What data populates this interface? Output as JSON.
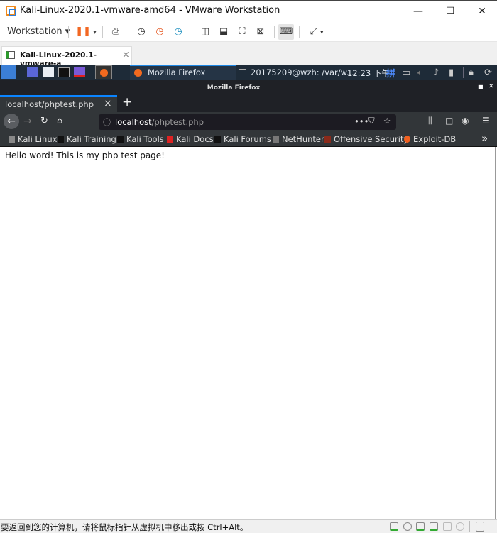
{
  "window": {
    "title": "Kali-Linux-2020.1-vmware-amd64 - VMware Workstation",
    "min": "—",
    "max": "☐",
    "close": "✕"
  },
  "toolbar": {
    "workstation_label": "Workstation"
  },
  "vm_tab": {
    "label": "Kali-Linux-2020.1-vmware-a...",
    "close": "×"
  },
  "panel": {
    "task_firefox": "Mozilla Firefox",
    "task_terminal": "20175209@wzh: /var/w...",
    "clock": "12:23 下午",
    "ime": "拼"
  },
  "firefox": {
    "window_title": "Mozilla Firefox",
    "tab": {
      "title": "localhost/phptest.php",
      "close": "×"
    },
    "new_tab": "+",
    "url": {
      "host": "localhost",
      "path": "/phptest.php"
    },
    "bookmarks": [
      {
        "label": "Kali Linux",
        "color": "#888"
      },
      {
        "label": "Kali Training",
        "color": "#000"
      },
      {
        "label": "Kali Tools",
        "color": "#000"
      },
      {
        "label": "Kali Docs",
        "color": "#d22"
      },
      {
        "label": "Kali Forums",
        "color": "#000"
      },
      {
        "label": "NetHunter",
        "color": "#888"
      },
      {
        "label": "Offensive Security",
        "color": "#8a2a1a"
      },
      {
        "label": "Exploit-DB",
        "color": "#f06020"
      }
    ],
    "overflow": "»"
  },
  "page": {
    "body_text": "Hello word! This is my php test page!"
  },
  "statusbar": {
    "message": "要返回到您的计算机，请将鼠标指针从虚拟机中移出或按 Ctrl+Alt。"
  }
}
